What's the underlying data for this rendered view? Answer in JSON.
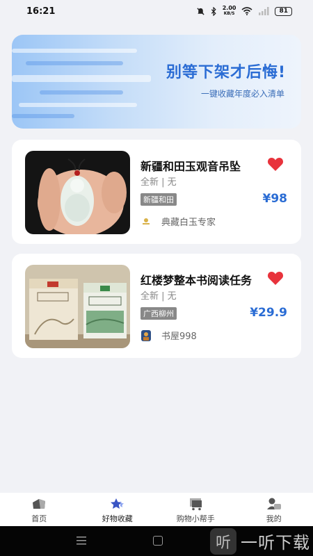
{
  "status": {
    "time": "16:21",
    "speed_value": "2.00",
    "speed_unit": "KB/S",
    "battery": "81"
  },
  "banner": {
    "title": "别等下架才后悔!",
    "subtitle": "一键收藏年度必入清单"
  },
  "favorites": [
    {
      "title": "新疆和田玉观音吊坠",
      "condition": "全新 | 无",
      "tag": "新疆和田",
      "price": "¥98",
      "shop": "典藏白玉专家"
    },
    {
      "title": "红楼梦整本书阅读任务",
      "condition": "全新 | 无",
      "tag": "广西柳州",
      "price": "¥29.9",
      "shop": "书屋998"
    }
  ],
  "tabbar": {
    "items": [
      {
        "label": "首页",
        "icon": "home-icon"
      },
      {
        "label": "好物收藏",
        "icon": "star-icon",
        "active": true
      },
      {
        "label": "购物小帮手",
        "icon": "cart-icon"
      },
      {
        "label": "我的",
        "icon": "user-icon"
      }
    ]
  },
  "watermark": {
    "glyph": "听",
    "text": "一听下载"
  },
  "colors": {
    "accent": "#2a6cd4",
    "heart": "#e8333c",
    "tag": "#888888"
  }
}
